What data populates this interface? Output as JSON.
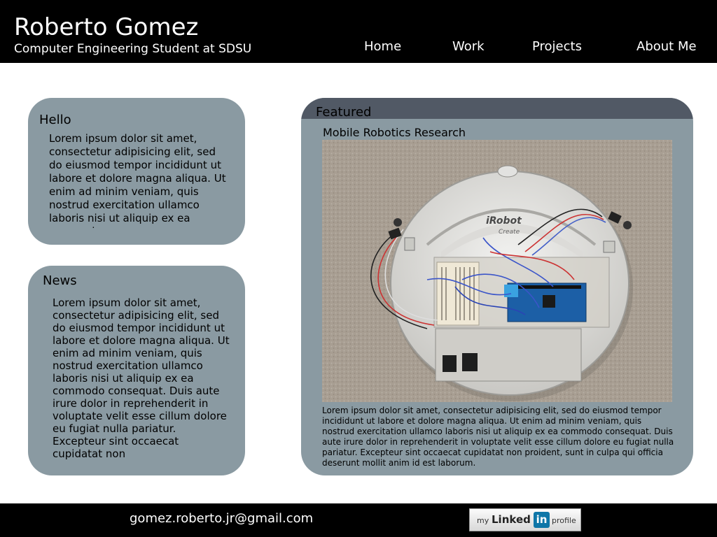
{
  "header": {
    "name": "Roberto Gomez",
    "tagline": "Computer Engineering Student at SDSU",
    "nav": {
      "home": "Home",
      "work": "Work",
      "projects": "Projects",
      "about": "About Me"
    }
  },
  "hello": {
    "title": "Hello",
    "body": "Lorem ipsum dolor sit amet, consectetur adipisicing elit, sed do eiusmod tempor incididunt ut labore et dolore magna aliqua. Ut enim ad minim veniam, quis nostrud exercitation ullamco laboris nisi ut aliquip ex ea commodo"
  },
  "news": {
    "title": "News",
    "body": "Lorem ipsum dolor sit amet, consectetur adipisicing elit, sed do eiusmod tempor incididunt ut labore et dolore magna aliqua. Ut enim ad minim veniam, quis nostrud exercitation ullamco laboris nisi ut aliquip ex ea commodo consequat. Duis aute irure dolor in reprehenderit in voluptate velit esse cillum dolore eu fugiat nulla pariatur. Excepteur sint occaecat cupidatat non"
  },
  "featured": {
    "title": "Featured",
    "project_title": "Mobile Robotics Research",
    "photo_logo_text": "iRobot",
    "photo_logo_sub": "Create",
    "description": "Lorem ipsum dolor sit amet, consectetur adipisicing elit, sed do eiusmod tempor incididunt ut labore et dolore magna aliqua. Ut enim ad minim veniam, quis nostrud exercitation ullamco laboris nisi ut aliquip ex ea commodo consequat. Duis aute irure dolor in reprehenderit in voluptate velit esse cillum dolore eu fugiat nulla pariatur. Excepteur sint occaecat cupidatat non proident, sunt in culpa qui officia deserunt mollit anim id est laborum."
  },
  "footer": {
    "email": "gomez.roberto.jr@gmail.com",
    "linkedin": {
      "my": "my",
      "linked": "Linked",
      "in": "in",
      "profile": "profile"
    }
  },
  "colors": {
    "header_bg": "#000000",
    "panel_bg": "#8a9aa2",
    "featured_head_bg": "#515965",
    "linkedin_blue": "#0e76a8"
  }
}
